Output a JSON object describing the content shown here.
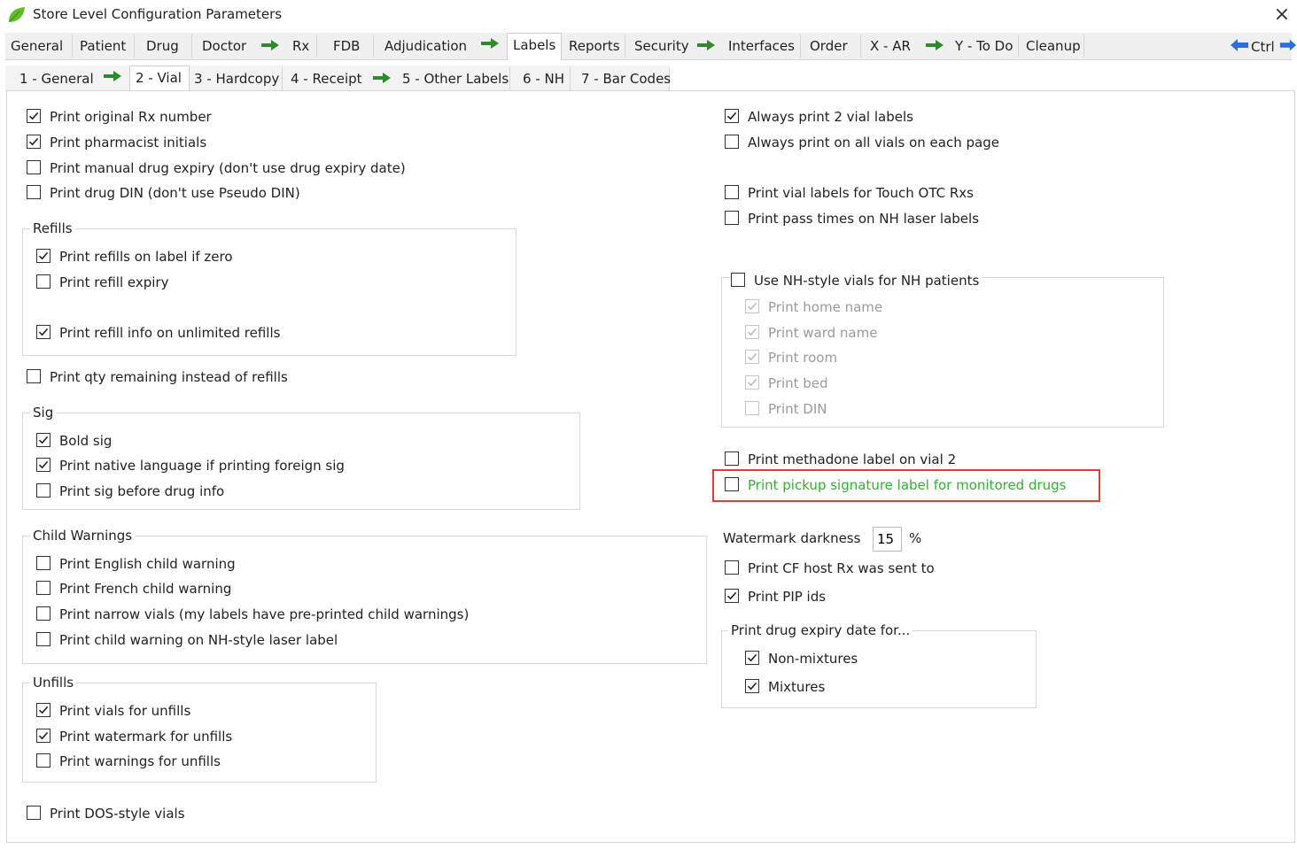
{
  "window": {
    "title": "Store Level Configuration Parameters",
    "close_label": "×",
    "accent_color": "#33b033",
    "highlight_color": "#e23a3a"
  },
  "main_tabs": [
    "General",
    "Patient",
    "Drug",
    "Doctor",
    "Rx",
    "FDB",
    "Adjudication",
    "Labels",
    "Reports",
    "Security",
    "Interfaces",
    "Order",
    "X - AR",
    "Y - To Do",
    "Cleanup"
  ],
  "nav": {
    "ctrl_label": "Ctrl"
  },
  "sub_tabs": [
    "1 - General",
    "2 - Vial",
    "3 - Hardcopy",
    "4 - Receipt",
    "5 - Other Labels",
    "6 - NH",
    "7 - Bar Codes"
  ],
  "left": {
    "top_options": [
      {
        "label": "Print original Rx number",
        "checked": true
      },
      {
        "label": "Print pharmacist initials",
        "checked": true
      },
      {
        "label": "Print manual drug expiry (don't use drug expiry date)",
        "checked": false
      },
      {
        "label": "Print drug DIN (don't use Pseudo DIN)",
        "checked": false
      }
    ],
    "refills": {
      "title": "Refills",
      "options": [
        {
          "label": "Print refills on label if zero",
          "checked": true
        },
        {
          "label": "Print refill expiry",
          "checked": false
        },
        {
          "label": "Print refill info on unlimited refills",
          "checked": true
        }
      ]
    },
    "qty_remaining": {
      "label": "Print qty remaining instead of refills",
      "checked": false
    },
    "sig": {
      "title": "Sig",
      "options": [
        {
          "label": "Bold sig",
          "checked": true
        },
        {
          "label": "Print native language if printing foreign sig",
          "checked": true
        },
        {
          "label": "Print sig before drug info",
          "checked": false
        }
      ]
    },
    "child_warnings": {
      "title": "Child Warnings",
      "options": [
        {
          "label": "Print English child warning",
          "checked": false
        },
        {
          "label": "Print French child warning",
          "checked": false
        },
        {
          "label": "Print narrow vials (my labels have pre-printed child warnings)",
          "checked": false
        },
        {
          "label": "Print child warning on NH-style laser label",
          "checked": false
        }
      ]
    },
    "unfills": {
      "title": "Unfills",
      "options": [
        {
          "label": "Print vials for unfills",
          "checked": true
        },
        {
          "label": "Print watermark for unfills",
          "checked": true
        },
        {
          "label": "Print warnings for unfills",
          "checked": false
        }
      ]
    },
    "dos_style": {
      "label": "Print DOS-style vials",
      "checked": false
    }
  },
  "right": {
    "top_options": [
      {
        "label": "Always print 2 vial labels",
        "checked": true
      },
      {
        "label": "Always print on all vials on each page",
        "checked": false
      },
      {
        "label": "Print vial labels for Touch OTC Rxs",
        "checked": false
      },
      {
        "label": "Print pass times on NH laser labels",
        "checked": false
      }
    ],
    "nh_style": {
      "title": "Use NH-style vials for NH patients",
      "checked": false,
      "options": [
        {
          "label": "Print home name",
          "checked": true
        },
        {
          "label": "Print ward name",
          "checked": true
        },
        {
          "label": "Print room",
          "checked": true
        },
        {
          "label": "Print bed",
          "checked": true
        },
        {
          "label": "Print DIN",
          "checked": false
        }
      ]
    },
    "methadone": {
      "label": "Print methadone label on vial 2",
      "checked": false
    },
    "pickup_signature": {
      "label": "Print pickup signature label for monitored drugs",
      "checked": false
    },
    "watermark": {
      "label": "Watermark darkness",
      "value": "15",
      "unit": "%"
    },
    "cf_host": {
      "label": "Print CF host Rx was sent to",
      "checked": false
    },
    "pip_ids": {
      "label": "Print PIP ids",
      "checked": true
    },
    "drug_expiry": {
      "title": "Print drug expiry date for...",
      "options": [
        {
          "label": "Non-mixtures",
          "checked": true
        },
        {
          "label": "Mixtures",
          "checked": true
        }
      ]
    }
  }
}
